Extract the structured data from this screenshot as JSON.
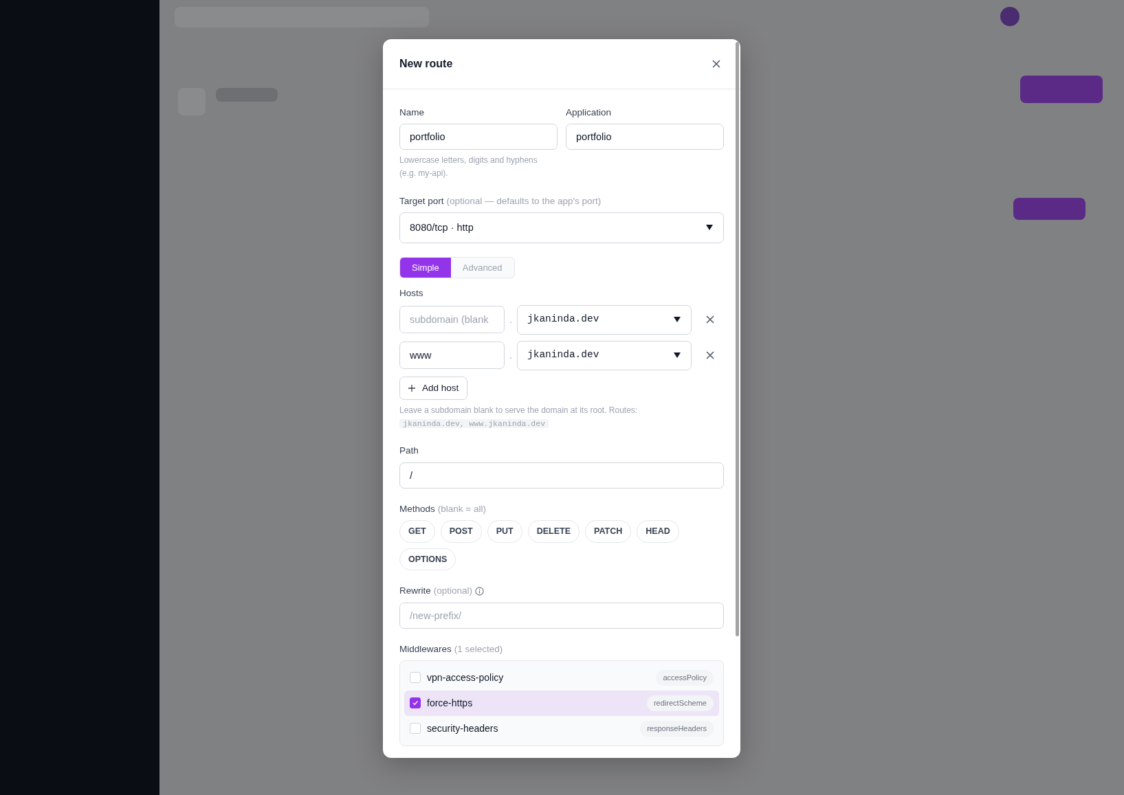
{
  "modal": {
    "title": "New route",
    "name": {
      "label": "Name",
      "value": "portfolio",
      "help": "Lowercase letters, digits and hyphens (e.g. my-api)."
    },
    "application": {
      "label": "Application",
      "value": "portfolio"
    },
    "target_port": {
      "label": "Target port",
      "hint": "(optional — defaults to the app's port)",
      "value": "8080/tcp · http"
    },
    "mode_tabs": [
      {
        "label": "Simple",
        "selected": true
      },
      {
        "label": "Advanced",
        "selected": false
      }
    ],
    "hosts": {
      "label": "Hosts",
      "rows": [
        {
          "subdomain_placeholder": "subdomain (blank",
          "separator": ".",
          "domain": "jkaninda.dev"
        },
        {
          "subdomain": "www",
          "separator": ".",
          "domain": "jkaninda.dev"
        }
      ],
      "add_button": "Add host",
      "help": "Leave a subdomain blank to serve the domain at its root. Routes:",
      "routes": "jkaninda.dev, www.jkaninda.dev"
    },
    "path": {
      "label": "Path",
      "value": "/"
    },
    "methods": {
      "label": "Methods",
      "hint": "(blank = all)",
      "items": [
        {
          "label": "GET",
          "selected": false
        },
        {
          "label": "POST",
          "selected": false
        },
        {
          "label": "PUT",
          "selected": false
        },
        {
          "label": "DELETE",
          "selected": false
        },
        {
          "label": "PATCH",
          "selected": false
        },
        {
          "label": "HEAD",
          "selected": false
        },
        {
          "label": "OPTIONS",
          "selected": false
        }
      ]
    },
    "rewrite": {
      "label": "Rewrite",
      "hint": "(optional)",
      "placeholder": "/new-prefix/"
    },
    "middlewares": {
      "label": "Middlewares",
      "hint": "(1 selected)",
      "items": [
        {
          "name": "vpn-access-policy",
          "type": "accessPolicy",
          "checked": false
        },
        {
          "name": "force-https",
          "type": "redirectScheme",
          "checked": true
        },
        {
          "name": "security-headers",
          "type": "responseHeaders",
          "checked": false
        }
      ]
    }
  }
}
